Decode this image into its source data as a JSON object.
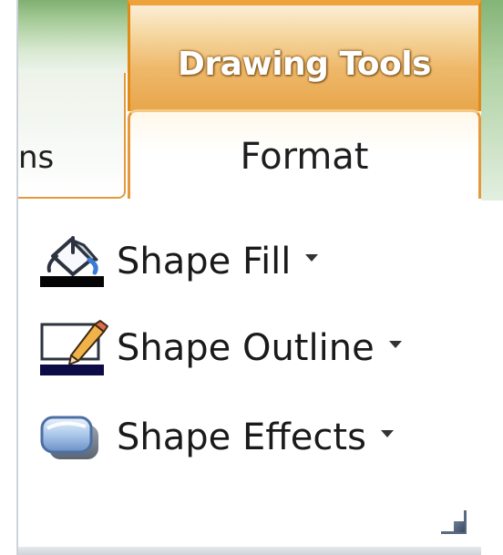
{
  "ribbon": {
    "context_group_title": "Drawing Tools",
    "previous_tab_label_fragment": "ns",
    "active_tab_label": "Format"
  },
  "commands": [
    {
      "label": "Shape Fill",
      "icon": "paint-bucket-icon"
    },
    {
      "label": "Shape Outline",
      "icon": "pencil-outline-icon"
    },
    {
      "label": "Shape Effects",
      "icon": "shape-effects-icon"
    }
  ],
  "group": {
    "launcher_icon": "dialog-launcher-icon"
  },
  "colors": {
    "context_accent": "#e7a64a",
    "fill_color_bar": "#050505",
    "outline_color_bar": "#0b0b46"
  }
}
